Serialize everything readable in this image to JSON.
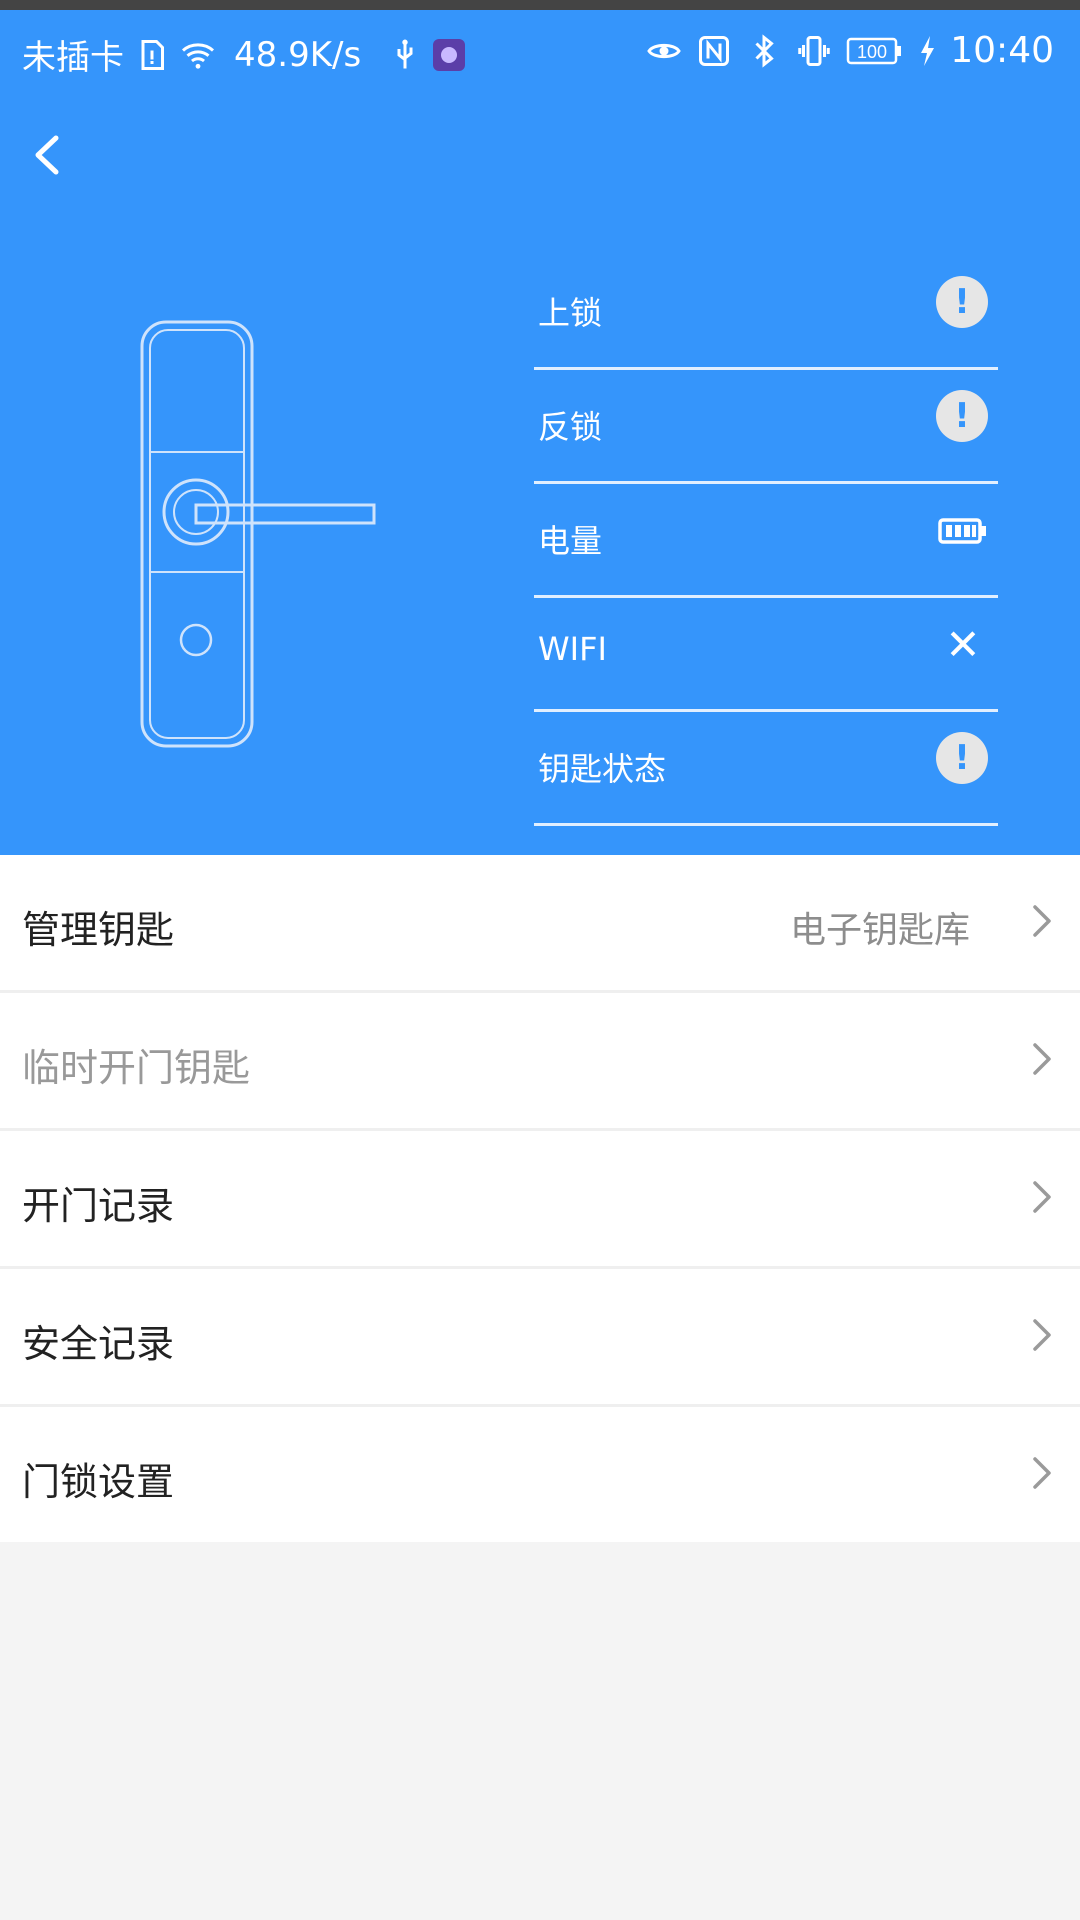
{
  "status_bar": {
    "carrier": "未插卡",
    "net_speed": "48.9K/s",
    "battery": "100",
    "time": "10:40",
    "icons": [
      "sim-icon",
      "wifi-icon",
      "usb-icon",
      "app-badge-icon",
      "eye-icon",
      "nfc-icon",
      "bluetooth-icon",
      "vibrate-icon",
      "battery-icon",
      "charging-icon"
    ]
  },
  "colors": {
    "header": "#3595fb",
    "divider": "#efefef",
    "background": "#f4f4f4"
  },
  "lock_status": [
    {
      "label": "上锁",
      "icon": "warning-icon"
    },
    {
      "label": "反锁",
      "icon": "warning-icon"
    },
    {
      "label": "电量",
      "icon": "battery-icon"
    },
    {
      "label": "WIFI",
      "icon": "close-icon"
    },
    {
      "label": "钥匙状态",
      "icon": "warning-icon"
    }
  ],
  "warning_glyph": "!",
  "close_glyph": "✕",
  "menu": [
    {
      "label": "管理钥匙",
      "value": "电子钥匙库",
      "enabled": true
    },
    {
      "label": "临时开门钥匙",
      "value": "",
      "enabled": false
    },
    {
      "label": "开门记录",
      "value": "",
      "enabled": true
    },
    {
      "label": "安全记录",
      "value": "",
      "enabled": true
    },
    {
      "label": "门锁设置",
      "value": "",
      "enabled": true
    }
  ]
}
